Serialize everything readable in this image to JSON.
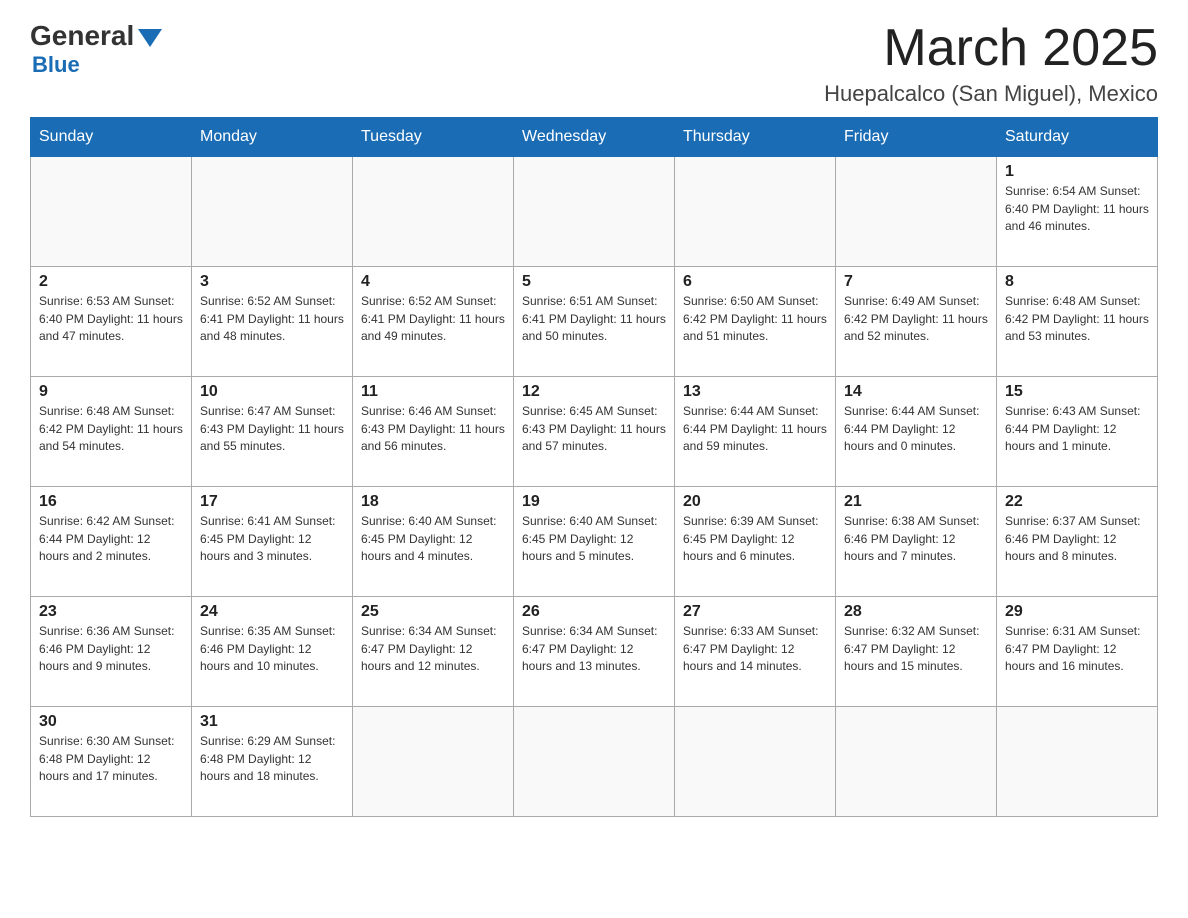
{
  "logo": {
    "general": "General",
    "blue": "Blue"
  },
  "header": {
    "month": "March 2025",
    "location": "Huepalcalco (San Miguel), Mexico"
  },
  "weekdays": [
    "Sunday",
    "Monday",
    "Tuesday",
    "Wednesday",
    "Thursday",
    "Friday",
    "Saturday"
  ],
  "weeks": [
    [
      {
        "day": "",
        "info": ""
      },
      {
        "day": "",
        "info": ""
      },
      {
        "day": "",
        "info": ""
      },
      {
        "day": "",
        "info": ""
      },
      {
        "day": "",
        "info": ""
      },
      {
        "day": "",
        "info": ""
      },
      {
        "day": "1",
        "info": "Sunrise: 6:54 AM\nSunset: 6:40 PM\nDaylight: 11 hours\nand 46 minutes."
      }
    ],
    [
      {
        "day": "2",
        "info": "Sunrise: 6:53 AM\nSunset: 6:40 PM\nDaylight: 11 hours\nand 47 minutes."
      },
      {
        "day": "3",
        "info": "Sunrise: 6:52 AM\nSunset: 6:41 PM\nDaylight: 11 hours\nand 48 minutes."
      },
      {
        "day": "4",
        "info": "Sunrise: 6:52 AM\nSunset: 6:41 PM\nDaylight: 11 hours\nand 49 minutes."
      },
      {
        "day": "5",
        "info": "Sunrise: 6:51 AM\nSunset: 6:41 PM\nDaylight: 11 hours\nand 50 minutes."
      },
      {
        "day": "6",
        "info": "Sunrise: 6:50 AM\nSunset: 6:42 PM\nDaylight: 11 hours\nand 51 minutes."
      },
      {
        "day": "7",
        "info": "Sunrise: 6:49 AM\nSunset: 6:42 PM\nDaylight: 11 hours\nand 52 minutes."
      },
      {
        "day": "8",
        "info": "Sunrise: 6:48 AM\nSunset: 6:42 PM\nDaylight: 11 hours\nand 53 minutes."
      }
    ],
    [
      {
        "day": "9",
        "info": "Sunrise: 6:48 AM\nSunset: 6:42 PM\nDaylight: 11 hours\nand 54 minutes."
      },
      {
        "day": "10",
        "info": "Sunrise: 6:47 AM\nSunset: 6:43 PM\nDaylight: 11 hours\nand 55 minutes."
      },
      {
        "day": "11",
        "info": "Sunrise: 6:46 AM\nSunset: 6:43 PM\nDaylight: 11 hours\nand 56 minutes."
      },
      {
        "day": "12",
        "info": "Sunrise: 6:45 AM\nSunset: 6:43 PM\nDaylight: 11 hours\nand 57 minutes."
      },
      {
        "day": "13",
        "info": "Sunrise: 6:44 AM\nSunset: 6:44 PM\nDaylight: 11 hours\nand 59 minutes."
      },
      {
        "day": "14",
        "info": "Sunrise: 6:44 AM\nSunset: 6:44 PM\nDaylight: 12 hours\nand 0 minutes."
      },
      {
        "day": "15",
        "info": "Sunrise: 6:43 AM\nSunset: 6:44 PM\nDaylight: 12 hours\nand 1 minute."
      }
    ],
    [
      {
        "day": "16",
        "info": "Sunrise: 6:42 AM\nSunset: 6:44 PM\nDaylight: 12 hours\nand 2 minutes."
      },
      {
        "day": "17",
        "info": "Sunrise: 6:41 AM\nSunset: 6:45 PM\nDaylight: 12 hours\nand 3 minutes."
      },
      {
        "day": "18",
        "info": "Sunrise: 6:40 AM\nSunset: 6:45 PM\nDaylight: 12 hours\nand 4 minutes."
      },
      {
        "day": "19",
        "info": "Sunrise: 6:40 AM\nSunset: 6:45 PM\nDaylight: 12 hours\nand 5 minutes."
      },
      {
        "day": "20",
        "info": "Sunrise: 6:39 AM\nSunset: 6:45 PM\nDaylight: 12 hours\nand 6 minutes."
      },
      {
        "day": "21",
        "info": "Sunrise: 6:38 AM\nSunset: 6:46 PM\nDaylight: 12 hours\nand 7 minutes."
      },
      {
        "day": "22",
        "info": "Sunrise: 6:37 AM\nSunset: 6:46 PM\nDaylight: 12 hours\nand 8 minutes."
      }
    ],
    [
      {
        "day": "23",
        "info": "Sunrise: 6:36 AM\nSunset: 6:46 PM\nDaylight: 12 hours\nand 9 minutes."
      },
      {
        "day": "24",
        "info": "Sunrise: 6:35 AM\nSunset: 6:46 PM\nDaylight: 12 hours\nand 10 minutes."
      },
      {
        "day": "25",
        "info": "Sunrise: 6:34 AM\nSunset: 6:47 PM\nDaylight: 12 hours\nand 12 minutes."
      },
      {
        "day": "26",
        "info": "Sunrise: 6:34 AM\nSunset: 6:47 PM\nDaylight: 12 hours\nand 13 minutes."
      },
      {
        "day": "27",
        "info": "Sunrise: 6:33 AM\nSunset: 6:47 PM\nDaylight: 12 hours\nand 14 minutes."
      },
      {
        "day": "28",
        "info": "Sunrise: 6:32 AM\nSunset: 6:47 PM\nDaylight: 12 hours\nand 15 minutes."
      },
      {
        "day": "29",
        "info": "Sunrise: 6:31 AM\nSunset: 6:47 PM\nDaylight: 12 hours\nand 16 minutes."
      }
    ],
    [
      {
        "day": "30",
        "info": "Sunrise: 6:30 AM\nSunset: 6:48 PM\nDaylight: 12 hours\nand 17 minutes."
      },
      {
        "day": "31",
        "info": "Sunrise: 6:29 AM\nSunset: 6:48 PM\nDaylight: 12 hours\nand 18 minutes."
      },
      {
        "day": "",
        "info": ""
      },
      {
        "day": "",
        "info": ""
      },
      {
        "day": "",
        "info": ""
      },
      {
        "day": "",
        "info": ""
      },
      {
        "day": "",
        "info": ""
      }
    ]
  ]
}
